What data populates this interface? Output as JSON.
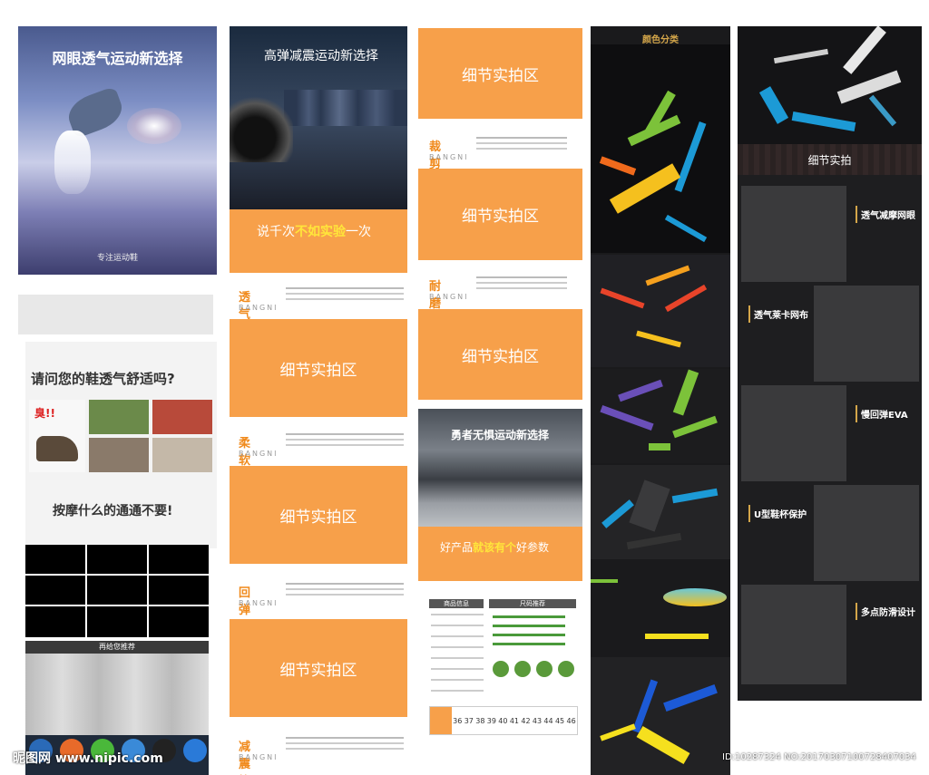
{
  "col1": {
    "poster_title": "网眼透气运动新选择",
    "poster_footer": "专注运动鞋",
    "question_title": "请问您的鞋透气舒适吗?",
    "stinky_label": "臭!!",
    "dont_want": "按摩什么的通通不要!",
    "recommend_header": "再给您推荐"
  },
  "col2": {
    "poster_title": "高弹减震运动新选择",
    "slogan_prefix": "说千次",
    "slogan_highlight": "不如实验",
    "slogan_suffix": "一次",
    "sections": [
      {
        "title": "透气篇",
        "sub": "BANGNI"
      },
      {
        "title": "柔软篇",
        "sub": "BANGNI"
      },
      {
        "title": "回弹篇",
        "sub": "BANGNI"
      },
      {
        "title": "减震篇",
        "sub": "BANGNI"
      }
    ],
    "detail_label": "细节实拍区"
  },
  "col3": {
    "detail_label": "细节实拍区",
    "sections": [
      {
        "title": "裁剪篇",
        "sub": "BANGNI"
      },
      {
        "title": "耐磨篇",
        "sub": "BANGNI"
      }
    ],
    "poster_title": "勇者无惧运动新选择",
    "param_prefix": "好产品",
    "param_highlight": "就该有个",
    "param_suffix": "好参数",
    "table_head_left": "商品信息",
    "table_head_right": "尺码推荐",
    "sizes": [
      "36",
      "37",
      "38",
      "39",
      "40",
      "41",
      "42",
      "43",
      "44",
      "45",
      "46"
    ]
  },
  "col4": {
    "title": "颜色分类",
    "colors": {
      "green": "#7cc23a",
      "blue": "#1c9ad6",
      "yellow": "#f5c01e",
      "orange": "#f06a1c",
      "purple": "#6a4fb8",
      "red": "#e8442a"
    }
  },
  "col5": {
    "tag": "细节实拍",
    "features": [
      "透气减摩网眼",
      "透气莱卡网布",
      "慢回弹EVA",
      "U型鞋杯保护",
      "多点防滑设计"
    ]
  },
  "watermark": {
    "logo": "昵图网 www.nipic.com",
    "id": "ID:10287324 NO:20170307100728407034"
  }
}
